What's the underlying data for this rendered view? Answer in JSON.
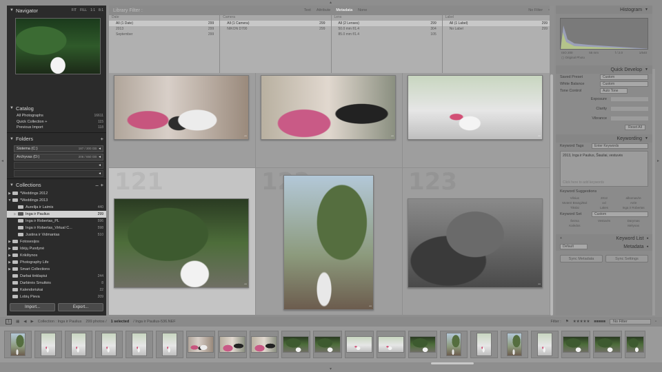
{
  "left": {
    "navigator": {
      "title": "Navigator",
      "opts": [
        "FIT",
        "FILL",
        "1:1",
        "8:1"
      ]
    },
    "catalog": {
      "title": "Catalog",
      "items": [
        {
          "label": "All Photographs",
          "count": "16611"
        },
        {
          "label": "Quick Collection +",
          "count": "115"
        },
        {
          "label": "Previous Import",
          "count": "118"
        }
      ]
    },
    "folders": {
      "title": "Folders",
      "items": [
        {
          "label": "Sistema (C:)",
          "size": "187 / 300 GB"
        },
        {
          "label": "Archyvas (D:)",
          "size": "206 / 650 GB"
        }
      ]
    },
    "collections": {
      "title": "Collections",
      "items": [
        {
          "label": "*Weddings 2012",
          "count": ""
        },
        {
          "label": "*Weddings 2013",
          "count": ""
        },
        {
          "label": "Aurelija ir Laimis",
          "count": "440"
        },
        {
          "label": "Inga ir Paulius",
          "count": "299"
        },
        {
          "label": "Inga ir Robertas_PL",
          "count": "596"
        },
        {
          "label": "Inga ir Robertas_Virtual C...",
          "count": "598"
        },
        {
          "label": "Justina ir Vidmantas",
          "count": "510"
        },
        {
          "label": "Fotosesijos",
          "count": ""
        },
        {
          "label": "Idėjų Puodynė",
          "count": ""
        },
        {
          "label": "Krikštynos",
          "count": ""
        },
        {
          "label": "Photography Life",
          "count": ""
        },
        {
          "label": "Smart Collections",
          "count": ""
        },
        {
          "label": "Darbai tinklapiui",
          "count": "244"
        },
        {
          "label": "Darbinės Šmutkės",
          "count": "8"
        },
        {
          "label": "Kalendoriukai",
          "count": "22"
        },
        {
          "label": "Lobių Pieva",
          "count": "209"
        }
      ]
    },
    "import_label": "Import...",
    "export_label": "Export..."
  },
  "filter": {
    "title": "Library Filter :",
    "tabs": [
      "Text",
      "Attribute",
      "Metadata",
      "None"
    ],
    "active_tab": "Metadata",
    "preset": "No Filter",
    "columns": [
      {
        "header": "Date",
        "rows": [
          {
            "label": "All (1 Date)",
            "count": "299"
          },
          {
            "label": "2013",
            "count": "299"
          },
          {
            "label": "September",
            "count": "299"
          }
        ]
      },
      {
        "header": "Camera",
        "rows": [
          {
            "label": "All (1 Camera)",
            "count": "299"
          },
          {
            "label": "NIKON D700",
            "count": "299"
          }
        ]
      },
      {
        "header": "Lens",
        "rows": [
          {
            "label": "All (2 Lenses)",
            "count": "299"
          },
          {
            "label": "50.0 mm f/1.4",
            "count": "304"
          },
          {
            "label": "85.0 mm f/1.4",
            "count": "105"
          }
        ]
      },
      {
        "header": "Label",
        "rows": [
          {
            "label": "All (1 Label)",
            "count": "299"
          },
          {
            "label": "No Label",
            "count": "299"
          }
        ]
      }
    ]
  },
  "grid": {
    "cell_numbers": [
      "121",
      "122",
      "123"
    ]
  },
  "right": {
    "histogram": {
      "title": "Histogram",
      "readout": [
        "ISO 200",
        "55 mm",
        "f / 2.0",
        "1/640"
      ],
      "original": "Original Photo"
    },
    "quick_develop": {
      "title": "Quick Develop",
      "saved_preset_label": "Saved Preset",
      "saved_preset": "Custom",
      "wb_label": "White Balance",
      "wb": "Custom",
      "tone_label": "Tone Control",
      "auto_tone": "Auto Tone",
      "rows": [
        "Exposure",
        "Clarity",
        "Vibrance"
      ],
      "reset": "Reset All"
    },
    "keywording": {
      "title": "Keywording",
      "tags_label": "Keyword Tags",
      "tags_mode": "Enter Keywords",
      "keywords": "2013, Inga ir Paulius, Šiauliai, vestuvės",
      "placeholder": "Click here to add keywords",
      "suggestions_label": "Keyword Suggestions",
      "suggestions": [
        "Vilnius",
        "2012",
        "albomas/re",
        "Moterė Brangi/Bol",
        "xxl",
        "Art/e",
        "Tikslai",
        "Lakes",
        "Inga ir Robertas"
      ],
      "set_label": "Keyword Set",
      "set": "Custom",
      "set_items": [
        "Šeima",
        "Vestuvės",
        "Darymas",
        "Kalėdos",
        "",
        "Mėlynas"
      ]
    },
    "keyword_list": {
      "title": "Keyword List"
    },
    "metadata": {
      "title": "Metadata",
      "preset": "Default"
    },
    "sync_metadata": "Sync Metadata",
    "sync_settings": "Sync Settings"
  },
  "toolbar": {
    "view": "1",
    "source": "Collection : Inga ir Paulius",
    "count": "299 photos /",
    "selected": "1 selected",
    "file": "/ Inga ir Paulius-536.NEF",
    "filter_label": "Filter :",
    "no_filter": "No Filter"
  }
}
